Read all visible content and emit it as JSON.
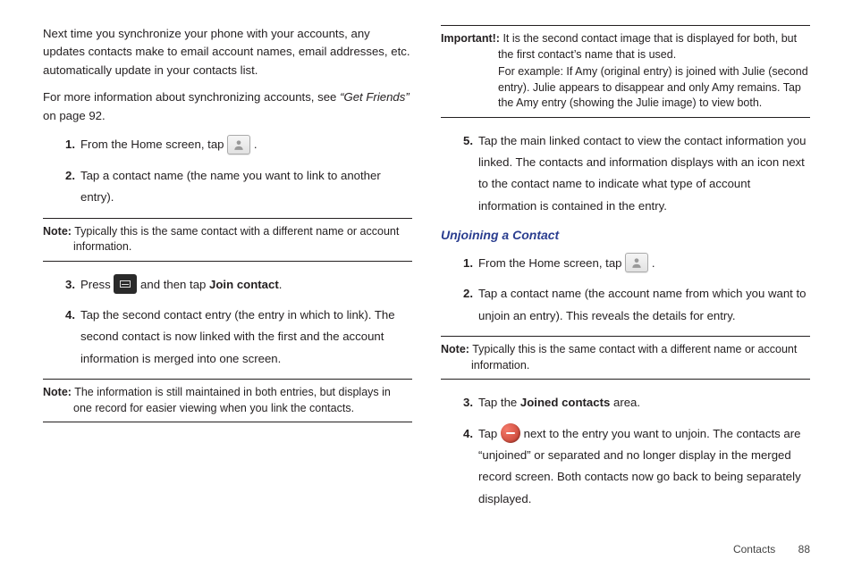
{
  "left": {
    "intro": "Next time you synchronize your phone with your accounts, any updates contacts make to email account names, email addresses, etc. automatically update in your contacts list.",
    "moreinfo_pre": "For more information about synchronizing accounts, see ",
    "moreinfo_ref": "“Get Friends”",
    "moreinfo_post": " on page 92.",
    "step1_a": "From the Home screen, tap ",
    "step1_b": " .",
    "step2": "Tap a contact name (the name you want to link to another entry).",
    "note1_label": "Note:",
    "note1_text": " Typically this is the same contact with a different name or account information.",
    "step3_a": "Press ",
    "step3_b": " and then tap ",
    "step3_bold": "Join contact",
    "step3_c": ".",
    "step4": "Tap the second contact entry (the entry in which to link). The second contact is now linked with the first and the account information is merged into one screen.",
    "note2_label": "Note:",
    "note2_text": " The information is still maintained in both entries, but displays in one record for easier viewing when you link the contacts."
  },
  "right": {
    "imp_label": "Important!:",
    "imp_text": " It is the second contact image that is displayed for both, but the first contact’s name that is used.",
    "imp_example": "For example: If Amy (original entry) is joined with Julie (second entry). Julie appears to disappear and only Amy remains. Tap the Amy entry (showing the Julie image) to view both.",
    "step5": "Tap the main linked contact to view the contact information you linked. The contacts and information displays with an icon next to the contact name to indicate what type of account information is contained in the entry.",
    "heading": "Unjoining a Contact",
    "u_step1_a": "From the Home screen, tap ",
    "u_step1_b": " .",
    "u_step2": "Tap a contact name (the account name from which you want to unjoin an entry). This reveals the details for entry.",
    "note_label": "Note:",
    "note_text": " Typically this is the same contact with a different name or account information.",
    "u_step3_a": "Tap the ",
    "u_step3_bold": "Joined contacts",
    "u_step3_b": " area.",
    "u_step4_a": "Tap ",
    "u_step4_b": " next to the entry you want to unjoin. The contacts are “unjoined” or separated and no longer display in the merged record screen. Both contacts now go back to being separately displayed."
  },
  "footer": {
    "section": "Contacts",
    "page": "88"
  }
}
